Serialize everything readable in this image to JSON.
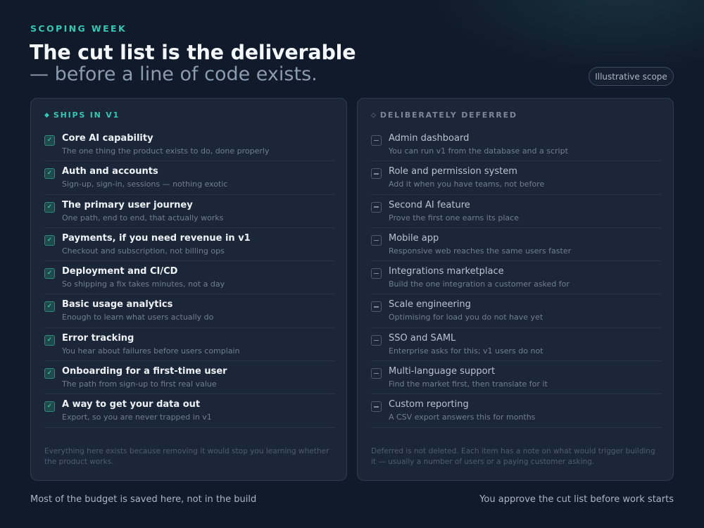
{
  "header": {
    "eyebrow": "SCOPING WEEK",
    "title": "The cut list is the deliverable",
    "subtitle": "— before a line of code exists.",
    "badge": "Illustrative scope"
  },
  "ships": {
    "icon": "diamond-filled-icon",
    "heading": "SHIPS IN V1",
    "items": [
      {
        "name": "Core AI capability",
        "desc": "The one thing the product exists to do, done properly"
      },
      {
        "name": "Auth and accounts",
        "desc": "Sign-up, sign-in, sessions — nothing exotic"
      },
      {
        "name": "The primary user journey",
        "desc": "One path, end to end, that actually works"
      },
      {
        "name": "Payments, if you need revenue in v1",
        "desc": "Checkout and subscription, not billing ops"
      },
      {
        "name": "Deployment and CI/CD",
        "desc": "So shipping a fix takes minutes, not a day"
      },
      {
        "name": "Basic usage analytics",
        "desc": "Enough to learn what users actually do"
      },
      {
        "name": "Error tracking",
        "desc": "You hear about failures before users complain"
      },
      {
        "name": "Onboarding for a first-time user",
        "desc": "The path from sign-up to first real value"
      },
      {
        "name": "A way to get your data out",
        "desc": "Export, so you are never trapped in v1"
      }
    ],
    "footnote": "Everything here exists because removing it would stop you learning whether the product works."
  },
  "deferred": {
    "icon": "diamond-outline-icon",
    "heading": "DELIBERATELY DEFERRED",
    "items": [
      {
        "name": "Admin dashboard",
        "desc": "You can run v1 from the database and a script"
      },
      {
        "name": "Role and permission system",
        "desc": "Add it when you have teams, not before"
      },
      {
        "name": "Second AI feature",
        "desc": "Prove the first one earns its place"
      },
      {
        "name": "Mobile app",
        "desc": "Responsive web reaches the same users faster"
      },
      {
        "name": "Integrations marketplace",
        "desc": "Build the one integration a customer asked for"
      },
      {
        "name": "Scale engineering",
        "desc": "Optimising for load you do not have yet"
      },
      {
        "name": "SSO and SAML",
        "desc": "Enterprise asks for this; v1 users do not"
      },
      {
        "name": "Multi-language support",
        "desc": "Find the market first, then translate for it"
      },
      {
        "name": "Custom reporting",
        "desc": "A CSV export answers this for months"
      }
    ],
    "footnote": "Deferred is not deleted. Each item has a note on what would trigger building it — usually a number of users or a paying customer asking."
  },
  "footer": {
    "left": "Most of the budget is saved here, not in the build",
    "right": "You approve the cut list before work starts"
  },
  "colors": {
    "background": "#101a2a",
    "panel": "#1b2738",
    "accent": "#35c7b4",
    "muted": "#7a8899"
  }
}
